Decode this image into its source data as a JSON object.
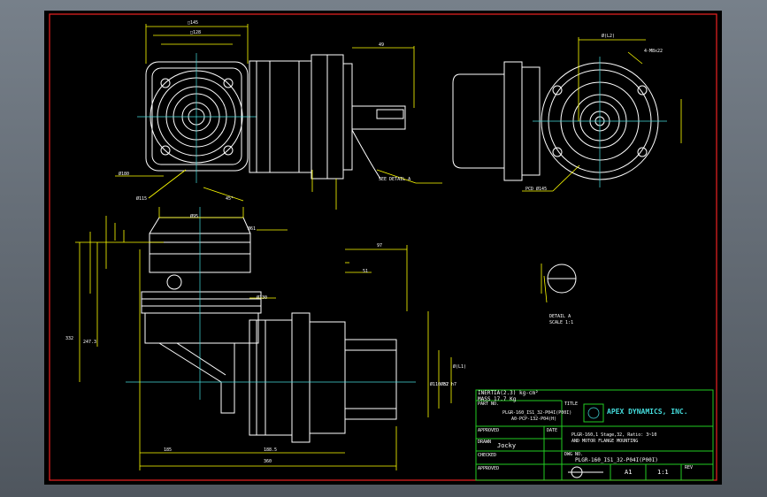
{
  "title_block": {
    "inertia": "INERTIA(2.3) kg-cm²",
    "mass": "MASS 17.7 Kg",
    "part_no_label": "PART NO.",
    "part_no_1": "PLGR-160_IS1_32-P04I(P00I)",
    "part_no_2": "A0-PCP-132-P04(H)",
    "approved_label": "APPROVED",
    "date_label": "DATE",
    "drawn_label": "DRAWN",
    "drawn_by": "Jocky",
    "checked_label": "CHECKED",
    "approved2_label": "APPROVED",
    "title_label": "TITLE",
    "company": "APEX DYNAMICS, INC.",
    "title_line1": "PLGR-160,1 Stage,32,  Ratio: 3~10",
    "title_line2": "AND MOTOR FLANGE MOUNTING",
    "dwg_no_label": "DWG NO.",
    "dwg_no": "PLGR-160_IS1_32-P04I(P00I)",
    "size": "A1",
    "scale": "1:1",
    "rev_label": "REV"
  },
  "annotations": {
    "section_a": "SEE DETAIL A",
    "detail_a": "DETAIL A",
    "detail_scale": "SCALE 1:1",
    "pcd": "PCD Ø145",
    "holes": "4-M8x22",
    "d180": "Ø180",
    "d115": "Ø115",
    "d95": "Ø95",
    "d61": "Ø61",
    "d32": "Ø32 h7",
    "d110": "Ø110 h7",
    "d130": "Ø130",
    "dim_45": "45°",
    "dim_90": "90",
    "dim_128": "□128",
    "dim_145": "□145",
    "dim_97": "97",
    "dim_51": "51",
    "dim_49": "49",
    "dim_360": "360",
    "dim_185": "185",
    "dim_1885": "188.5",
    "dim_332": "332",
    "dim_2473": "247.3",
    "dim_85": "85",
    "dim_4": "4",
    "key": "Ø(L1)",
    "top_ref": "Ø(L2)"
  },
  "colors": {
    "background": "#000000",
    "outline": "#ffffff",
    "dimension": "#ffff00",
    "centerline": "#44dddd",
    "border": "#dd2222",
    "titleblock": "#22cc22"
  }
}
